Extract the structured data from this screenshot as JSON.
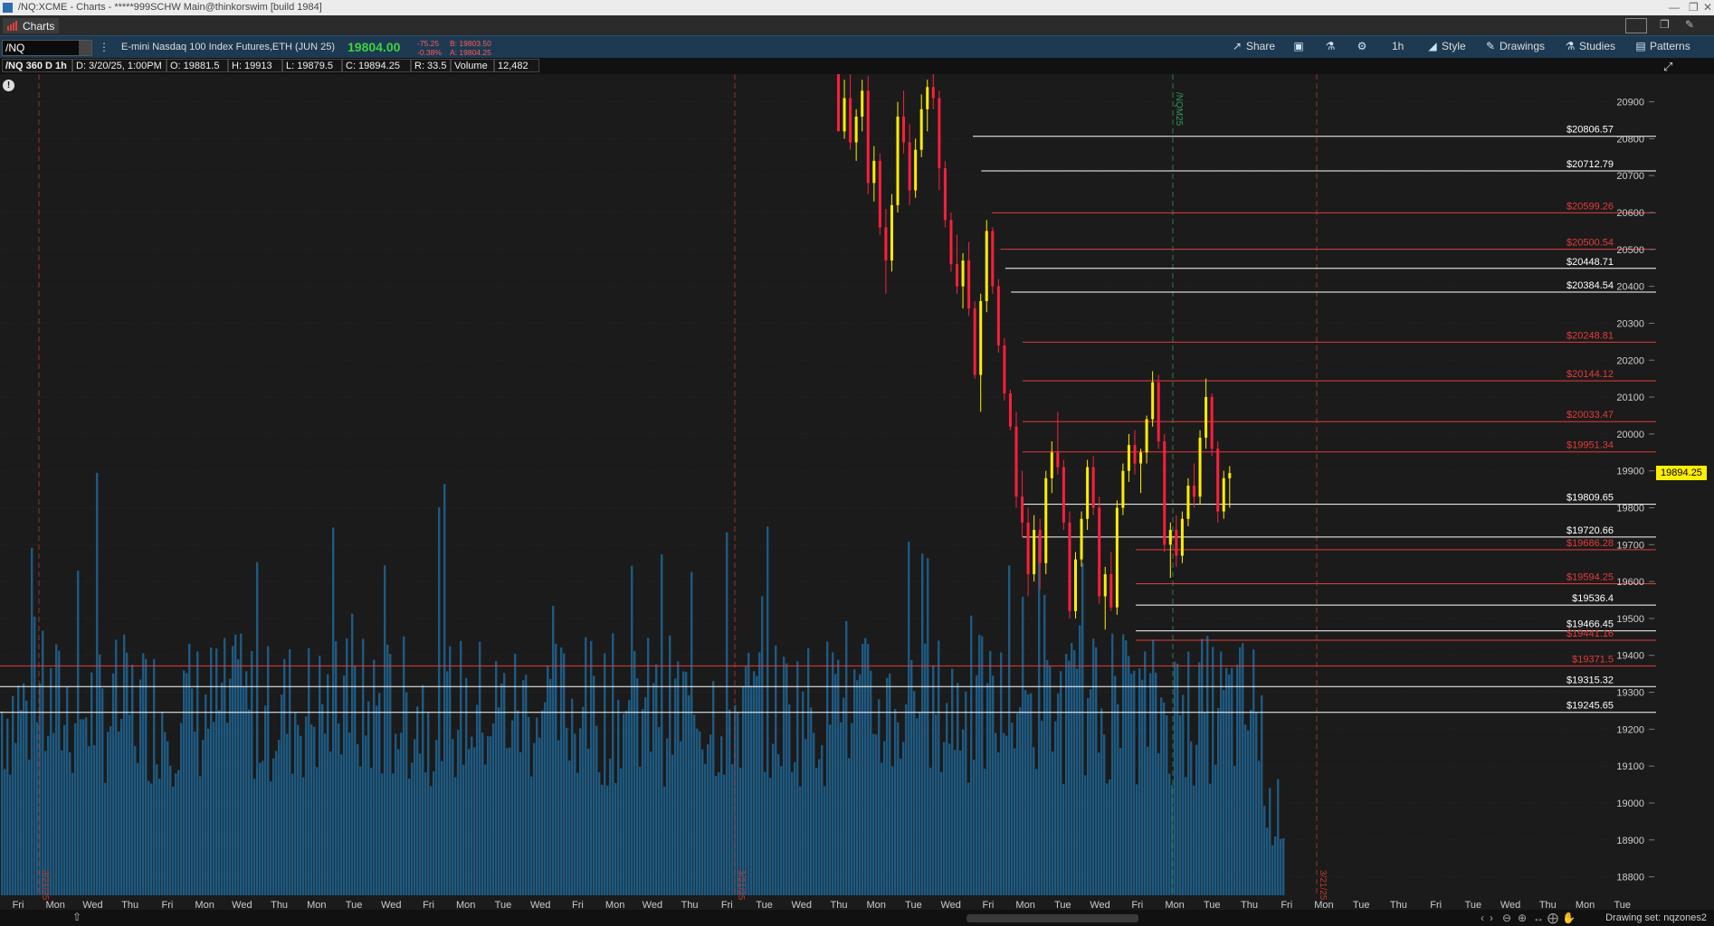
{
  "window": {
    "title": "/NQ:XCME - Charts - *****999SCHW Main@thinkorswim [build 1984]",
    "tab": "Charts"
  },
  "toolbar": {
    "symbol": "/NQ",
    "description": "E-mini Nasdaq 100 Index Futures,ETH (JUN 25)",
    "last_price": "19804.00",
    "net_change": "-75.25",
    "pct_change": "-0.38%",
    "bid": "B: 19803.50",
    "ask": "A: 19804.25",
    "share_label": "Share",
    "timeframe_label": "1h",
    "style_label": "Style",
    "drawings_label": "Drawings",
    "studies_label": "Studies",
    "patterns_label": "Patterns"
  },
  "infobar": {
    "chart_label": "/NQ 360 D 1h",
    "date": "D: 3/20/25, 1:00PM",
    "open": "O: 19881.5",
    "high": "H: 19913",
    "low": "L: 19879.5",
    "close": "C: 19894.25",
    "range": "R: 33.5",
    "volume_label": "Volume",
    "volume_value": "12,482"
  },
  "current_price_tag": "19894.25",
  "footer": {
    "drawing_set": "Drawing set: nqzones2"
  },
  "colors": {
    "background": "#1b1b1b",
    "toolbar": "#1d3a52",
    "volume": "#1e5a82",
    "up_candle": "#ffee00",
    "down_candle": "#ff1e3c",
    "resistance": "#e23c3c",
    "support": "#ffffff"
  },
  "icons": [
    "share-icon",
    "snapshot-icon",
    "flask-icon",
    "gear-icon",
    "style-icon",
    "drawings-icon",
    "studies-icon",
    "patterns-icon"
  ],
  "chart_data": {
    "type": "candlestick",
    "timeframe": "1h",
    "y_range": [
      18750,
      20975
    ],
    "y_ticks": [
      18800,
      18900,
      19000,
      19100,
      19200,
      19300,
      19400,
      19500,
      19600,
      19700,
      19800,
      19900,
      20000,
      20100,
      20200,
      20300,
      20400,
      20500,
      20600,
      20700,
      20800,
      20900
    ],
    "x_ticks": [
      "Fri",
      "Mon",
      "Wed",
      "Thu",
      "Fri",
      "Mon",
      "Wed",
      "Thu",
      "Mon",
      "Tue",
      "Wed",
      "Fri",
      "Mon",
      "Tue",
      "Wed",
      "Fri",
      "Mon",
      "Wed",
      "Thu",
      "Fri",
      "Tue",
      "Wed",
      "Thu",
      "Mon",
      "Tue",
      "Wed",
      "Fri",
      "Mon",
      "Tue",
      "Wed",
      "Fri",
      "Mon",
      "Tue",
      "Thu",
      "Fri",
      "Mon",
      "Tue",
      "Thu",
      "Fri",
      "Tue",
      "Wed",
      "Thu",
      "Mon",
      "Tue"
    ],
    "vertical_markers": [
      "3/21/25",
      "3/21/25",
      "/NQM25",
      "3/21/25"
    ],
    "price_levels": [
      {
        "label": "$20806.57",
        "value": 20806.57,
        "kind": "support"
      },
      {
        "label": "$20712.79",
        "value": 20712.79,
        "kind": "support"
      },
      {
        "label": "$20599.26",
        "value": 20599.26,
        "kind": "resistance"
      },
      {
        "label": "$20500.54",
        "value": 20500.54,
        "kind": "resistance"
      },
      {
        "label": "$20448.71",
        "value": 20448.71,
        "kind": "support"
      },
      {
        "label": "$20384.54",
        "value": 20384.54,
        "kind": "support"
      },
      {
        "label": "$20248.81",
        "value": 20248.81,
        "kind": "resistance"
      },
      {
        "label": "$20144.12",
        "value": 20144.12,
        "kind": "resistance"
      },
      {
        "label": "$20033.47",
        "value": 20033.47,
        "kind": "resistance"
      },
      {
        "label": "$19951.34",
        "value": 19951.34,
        "kind": "resistance"
      },
      {
        "label": "$19809.65",
        "value": 19809.65,
        "kind": "support"
      },
      {
        "label": "$19720.66",
        "value": 19720.66,
        "kind": "support"
      },
      {
        "label": "$19686.28",
        "value": 19686.28,
        "kind": "resistance"
      },
      {
        "label": "$19594.25",
        "value": 19594.25,
        "kind": "resistance"
      },
      {
        "label": "$19536.4",
        "value": 19536.4,
        "kind": "support"
      },
      {
        "label": "$19466.45",
        "value": 19466.45,
        "kind": "support"
      },
      {
        "label": "$19441.16",
        "value": 19441.16,
        "kind": "resistance"
      },
      {
        "label": "$19371.5",
        "value": 19371.5,
        "kind": "resistance"
      },
      {
        "label": "$19315.32",
        "value": 19315.32,
        "kind": "support"
      },
      {
        "label": "$19245.65",
        "value": 19245.65,
        "kind": "support"
      }
    ],
    "candles": [
      [
        20975,
        21050,
        20880,
        20820
      ],
      [
        20820,
        20960,
        20800,
        20910
      ],
      [
        20910,
        20990,
        20770,
        20790
      ],
      [
        20790,
        20880,
        20740,
        20860
      ],
      [
        20860,
        20960,
        20820,
        20930
      ],
      [
        20930,
        20970,
        20650,
        20680
      ],
      [
        20680,
        20780,
        20630,
        20740
      ],
      [
        20740,
        20760,
        20540,
        20560
      ],
      [
        20560,
        20610,
        20380,
        20470
      ],
      [
        20470,
        20650,
        20440,
        20620
      ],
      [
        20620,
        20900,
        20600,
        20860
      ],
      [
        20860,
        20930,
        20760,
        20790
      ],
      [
        20790,
        20840,
        20620,
        20660
      ],
      [
        20660,
        20800,
        20640,
        20770
      ],
      [
        20770,
        20920,
        20750,
        20880
      ],
      [
        20880,
        20960,
        20820,
        20940
      ],
      [
        20940,
        21000,
        20880,
        20910
      ],
      [
        20910,
        20930,
        20660,
        20720
      ],
      [
        20720,
        20740,
        20560,
        20580
      ],
      [
        20580,
        20600,
        20440,
        20460
      ],
      [
        20460,
        20540,
        20380,
        20400
      ],
      [
        20400,
        20490,
        20340,
        20470
      ],
      [
        20470,
        20520,
        20320,
        20340
      ],
      [
        20340,
        20360,
        20150,
        20160
      ],
      [
        20160,
        20380,
        20060,
        20360
      ],
      [
        20360,
        20580,
        20330,
        20550
      ],
      [
        20550,
        20560,
        20380,
        20400
      ],
      [
        20400,
        20420,
        20220,
        20240
      ],
      [
        20240,
        20260,
        20090,
        20110
      ],
      [
        20110,
        20120,
        20010,
        20020
      ],
      [
        20020,
        20060,
        19800,
        19830
      ],
      [
        19830,
        19900,
        19720,
        19760
      ],
      [
        19760,
        19800,
        19560,
        19620
      ],
      [
        19620,
        19780,
        19600,
        19740
      ],
      [
        19740,
        19770,
        19580,
        19650
      ],
      [
        19650,
        19900,
        19620,
        19880
      ],
      [
        19880,
        19980,
        19840,
        19950
      ],
      [
        19950,
        20060,
        19890,
        19910
      ],
      [
        19910,
        19930,
        19740,
        19760
      ],
      [
        19760,
        19790,
        19500,
        19520
      ],
      [
        19520,
        19680,
        19500,
        19660
      ],
      [
        19660,
        19790,
        19640,
        19770
      ],
      [
        19770,
        19930,
        19740,
        19910
      ],
      [
        19910,
        19940,
        19780,
        19800
      ],
      [
        19800,
        19830,
        19540,
        19560
      ],
      [
        19560,
        19640,
        19470,
        19620
      ],
      [
        19620,
        19680,
        19520,
        19530
      ],
      [
        19530,
        19820,
        19510,
        19800
      ],
      [
        19800,
        19920,
        19780,
        19900
      ],
      [
        19900,
        20000,
        19870,
        19970
      ],
      [
        19970,
        20010,
        19890,
        19920
      ],
      [
        19920,
        19960,
        19840,
        19950
      ],
      [
        19950,
        20050,
        19920,
        20040
      ],
      [
        20040,
        20170,
        20020,
        20140
      ],
      [
        20140,
        20160,
        19960,
        19980
      ],
      [
        19980,
        20000,
        19680,
        19700
      ],
      [
        19700,
        19760,
        19610,
        19740
      ],
      [
        19740,
        19780,
        19640,
        19670
      ],
      [
        19670,
        19790,
        19650,
        19770
      ],
      [
        19770,
        19880,
        19750,
        19860
      ],
      [
        19860,
        19920,
        19800,
        19830
      ],
      [
        19830,
        20010,
        19810,
        19990
      ],
      [
        19990,
        20150,
        19960,
        20100
      ],
      [
        20100,
        20110,
        19940,
        19960
      ],
      [
        19960,
        19980,
        19760,
        19790
      ],
      [
        19790,
        19900,
        19770,
        19880
      ],
      [
        19880,
        19913,
        19800,
        19894
      ]
    ]
  }
}
